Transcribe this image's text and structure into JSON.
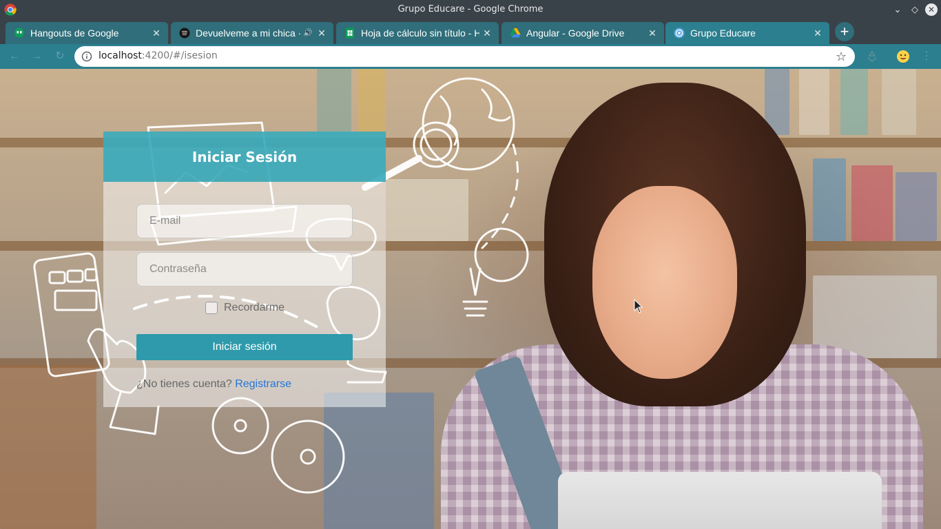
{
  "window": {
    "title": "Grupo Educare - Google Chrome",
    "controls": [
      "chevron-down-icon",
      "diamond-icon",
      "close-icon"
    ]
  },
  "tabs": [
    {
      "title": "Hangouts de Google",
      "favicon": "hangouts-icon",
      "active": false,
      "audio": false
    },
    {
      "title": "Devuelveme a mi chica · H",
      "favicon": "spotify-icon",
      "active": false,
      "audio": true
    },
    {
      "title": "Hoja de cálculo sin título - Ho",
      "favicon": "sheets-icon",
      "active": false,
      "audio": false
    },
    {
      "title": "Angular - Google Drive",
      "favicon": "drive-icon",
      "active": false,
      "audio": false
    },
    {
      "title": "Grupo Educare",
      "favicon": "educare-icon",
      "active": true,
      "audio": false
    }
  ],
  "toolbar": {
    "url_host": "localhost",
    "url_rest": ":4200/#/isesion"
  },
  "login": {
    "title": "Iniciar Sesión",
    "email_placeholder": "E-mail",
    "password_placeholder": "Contraseña",
    "remember_label": "Recordarme",
    "submit_label": "Iniciar sesión",
    "no_account_text": "¿No tienes cuenta?",
    "register_link": "Registrarse"
  },
  "colors": {
    "tab_inactive": "#2f6e7a",
    "tab_active": "#2b7f8f",
    "login_header": "#2ba3b5",
    "login_button": "#2e9aab",
    "link": "#2673d8"
  }
}
